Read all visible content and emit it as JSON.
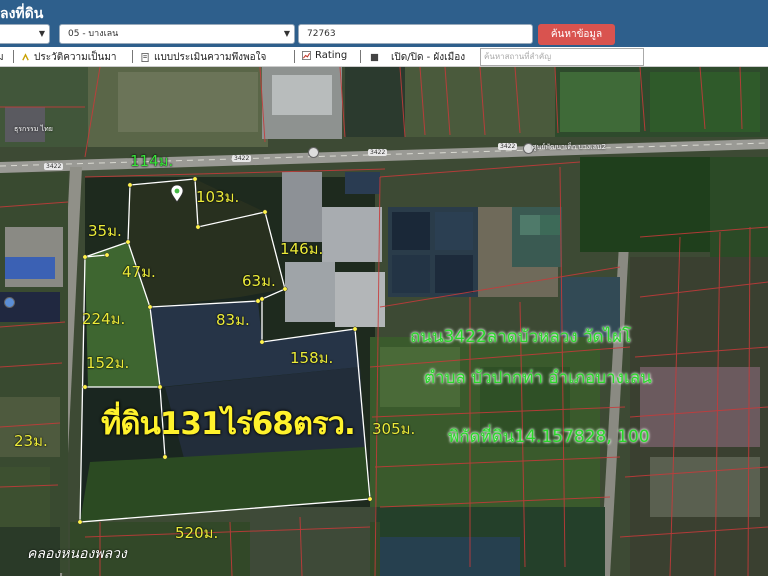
{
  "header": {
    "title": "ลงที่ดิน",
    "district_select": "05 - บางเลน",
    "parcel_input": "72763",
    "search_button": "ค้นหาข้อมูล"
  },
  "toolbar": {
    "items": [
      {
        "label": "ม",
        "icon": "menu-icon"
      },
      {
        "label": "ประวัติความเป็นมา",
        "icon": "history-icon"
      },
      {
        "label": "แบบประเมินความพึงพอใจ",
        "icon": "document-icon"
      },
      {
        "label": "Rating",
        "icon": "chart-icon"
      },
      {
        "label": "เปิด/ปิด - ผังเมือง",
        "icon": "square-icon"
      }
    ],
    "place_search_placeholder": "ค้นหาสถานที่สำคัญ"
  },
  "map": {
    "road_labels": [
      "3422",
      "3422",
      "3422",
      "3422"
    ],
    "poi_label": "ศูนย์พัฒนาเด็ก บางเลน2",
    "top_left_label": "ธุรกรรม ไทย",
    "measurements": {
      "m114": "114ม.",
      "m103": "103ม.",
      "m35": "35ม.",
      "m146": "146ม.",
      "m47": "47ม.",
      "m63": "63ม.",
      "m224": "224ม.",
      "m83": "83ม.",
      "m158": "158ม.",
      "m152": "152ม.",
      "m305": "305ม.",
      "m23": "23ม.",
      "m520": "520ม."
    },
    "overlay": {
      "area_text": "ที่ดิน131ไร่68ตรว.",
      "line1": "ถนน3422ลาดบัวหลวง วัดไผ่โ",
      "line2": "ตำบล บัวปากท่า อำเภอบางเลน",
      "line3": "พิกัดที่ดิน14.157828, 100"
    },
    "canal_label": "คลองหนองพลวง"
  },
  "colors": {
    "header_bg": "#2e5f8c",
    "search_btn": "#d9534f",
    "measure_text": "#ecec3a",
    "overlay_green": "#2bd62b",
    "boundary": "#ffffff"
  }
}
